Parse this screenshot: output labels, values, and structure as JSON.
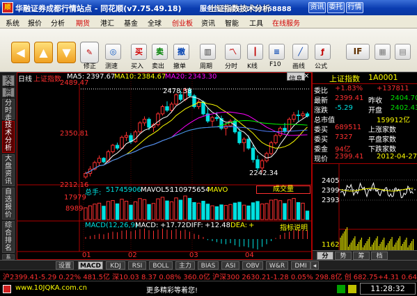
{
  "window": {
    "title": "华融证券成都行情站点 - 同花顺(v7.75.49.18)",
    "overlay": "服务热线:0571-56768888",
    "overlay_title": "上证指数技术分析",
    "buttons": [
      "资讯",
      "委托",
      "行情"
    ]
  },
  "menu": [
    "系统",
    "报价",
    "分析",
    "期货",
    "港汇",
    "基金",
    "全球",
    "创业板",
    "资讯",
    "智能",
    "工具",
    "在线服务"
  ],
  "menu_red": [
    "期货",
    "创业板",
    "在线服务"
  ],
  "toolbar": {
    "labels": [
      "修正",
      "测速",
      "买入",
      "卖出",
      "撤单",
      "周期",
      "分时",
      "K线",
      "F10",
      "画线",
      "公式"
    ],
    "buy_char": "买",
    "sell_char": "卖",
    "cancel_char": "撤",
    "if_label": "IF"
  },
  "left_tabs": [
    "分时走势",
    "技术分析",
    "大盘资讯",
    "自选报价",
    "综合排名",
    "系"
  ],
  "left_top_label": "关注",
  "left_top_label2": "资讯",
  "chart_header": {
    "period": "日线",
    "name": "上证指数",
    "ma5_label": "MA5:",
    "ma5": "2397.67",
    "ma10_label": "MA10:",
    "ma10": "2384.67",
    "ma20_label": "MA20:",
    "ma20": "2343.30",
    "info_btn": "信息",
    "info_close": "×"
  },
  "kline_axis": [
    "2489.47",
    "2350.81",
    "2212.16"
  ],
  "kline_annotations": {
    "high": "2478.38",
    "low": "2242.34"
  },
  "vol_header": {
    "label": "总手:",
    "value": "51745906",
    "mavol5_label": "MAVOL5:",
    "mavol5": "110975654",
    "mavol10_label": "MAVO",
    "selector": "成交量"
  },
  "vol_axis": [
    "17979",
    "8989"
  ],
  "macd_header": {
    "label": "MACD(12,26,9)",
    "macd_label": "MACD:",
    "macd": "+17.72",
    "diff_label": "DIFF:",
    "diff": "+12.48",
    "dea_label": "DEA:",
    "dea": "+",
    "btn": "指标说明"
  },
  "date_axis": [
    "01",
    "02",
    "03",
    "04"
  ],
  "right_panel": {
    "name": "上证指数",
    "code": "1A0001",
    "rows": [
      {
        "l": "委比",
        "v": "+1.83%",
        "r": "+137811"
      },
      {
        "l": "最新",
        "v": "2399.41",
        "l2": "昨收",
        "v2": "2404.70"
      },
      {
        "l": "涨跌",
        "v": "-5.29",
        "l2": "开盘",
        "v2": "2402.43"
      },
      {
        "l": "总市值",
        "v": "",
        "r": "159912亿"
      },
      {
        "l": "委买",
        "v": "689511",
        "l2": "上涨家数",
        "v2": ""
      },
      {
        "l": "委买",
        "v": "7327",
        "l2": "平盘家数",
        "v2": ""
      },
      {
        "l": "委金",
        "v": "94亿",
        "l2": "下跌家数",
        "v2": ""
      },
      {
        "l": "现价",
        "v": "2399.41",
        "r": "2012-04-27"
      }
    ],
    "mini_axis": [
      "2405",
      "2399",
      "2393"
    ],
    "mini_vol": "1162",
    "tabs": [
      "分",
      "势",
      "筹",
      "档"
    ]
  },
  "bottom_tabs": [
    "设置",
    "MACD",
    "KDJ",
    "RSI",
    "BOLL",
    "主力",
    "BIAS",
    "ASI",
    "OBV",
    "W&R",
    "DMI"
  ],
  "ticker": "沪2399.41-5.29 0.22% 481.5亿 深10.03 8.37 0.08% 360.0亿 沪深300 2630.21-1.28 0.05% 298.8亿 创 682.75+4.31 0.64%",
  "status": {
    "url": "www.10JQKA.com.cn",
    "promo": "更多精彩等着您!",
    "time": "11:28:32"
  },
  "colors": {
    "up": "#ff3030",
    "down": "#00e0e0",
    "ma5": "#ffffff",
    "ma10": "#ffff00",
    "ma20": "#ff00ff",
    "ma30": "#00ff00",
    "ma60": "#5080ff",
    "frame": "#b00000"
  },
  "chart_data": [
    {
      "type": "candlestick",
      "title": "上证指数 日线",
      "yaxis": [
        2212.16,
        2489.47
      ],
      "x_ticks": [
        "01",
        "02",
        "03",
        "04"
      ],
      "ohlc": [
        [
          2230,
          2245,
          2225,
          2240
        ],
        [
          2240,
          2260,
          2232,
          2252
        ],
        [
          2252,
          2275,
          2248,
          2270
        ],
        [
          2270,
          2290,
          2262,
          2282
        ],
        [
          2282,
          2285,
          2268,
          2272
        ],
        [
          2272,
          2305,
          2270,
          2300
        ],
        [
          2300,
          2322,
          2295,
          2318
        ],
        [
          2318,
          2325,
          2305,
          2310
        ],
        [
          2310,
          2345,
          2308,
          2340
        ],
        [
          2340,
          2355,
          2330,
          2345
        ],
        [
          2345,
          2352,
          2322,
          2328
        ],
        [
          2328,
          2360,
          2325,
          2355
        ],
        [
          2355,
          2385,
          2350,
          2380
        ],
        [
          2380,
          2398,
          2372,
          2390
        ],
        [
          2390,
          2395,
          2360,
          2368
        ],
        [
          2368,
          2380,
          2355,
          2375
        ],
        [
          2375,
          2410,
          2370,
          2405
        ],
        [
          2405,
          2430,
          2400,
          2425
        ],
        [
          2425,
          2440,
          2410,
          2415
        ],
        [
          2415,
          2438,
          2408,
          2432
        ],
        [
          2432,
          2462,
          2428,
          2458
        ],
        [
          2458,
          2470,
          2440,
          2445
        ],
        [
          2445,
          2478,
          2440,
          2472
        ],
        [
          2472,
          2478,
          2450,
          2455
        ],
        [
          2455,
          2460,
          2420,
          2425
        ],
        [
          2425,
          2445,
          2418,
          2438
        ],
        [
          2438,
          2442,
          2400,
          2405
        ],
        [
          2405,
          2420,
          2380,
          2385
        ],
        [
          2385,
          2400,
          2370,
          2395
        ],
        [
          2395,
          2410,
          2385,
          2392
        ],
        [
          2392,
          2400,
          2360,
          2365
        ],
        [
          2365,
          2380,
          2345,
          2372
        ],
        [
          2372,
          2390,
          2368,
          2385
        ],
        [
          2385,
          2392,
          2350,
          2355
        ],
        [
          2355,
          2365,
          2320,
          2325
        ],
        [
          2325,
          2340,
          2300,
          2335
        ],
        [
          2335,
          2345,
          2305,
          2310
        ],
        [
          2310,
          2320,
          2270,
          2278
        ],
        [
          2278,
          2290,
          2248,
          2255
        ],
        [
          2255,
          2280,
          2242,
          2275
        ],
        [
          2275,
          2300,
          2270,
          2295
        ],
        [
          2295,
          2330,
          2290,
          2325
        ],
        [
          2325,
          2350,
          2320,
          2345
        ],
        [
          2345,
          2370,
          2340,
          2365
        ],
        [
          2365,
          2380,
          2350,
          2358
        ],
        [
          2358,
          2395,
          2355,
          2390
        ],
        [
          2390,
          2410,
          2382,
          2402
        ],
        [
          2402,
          2415,
          2385,
          2400
        ],
        [
          2400,
          2412,
          2392,
          2405
        ],
        [
          2405,
          2410,
          2395,
          2399
        ]
      ]
    },
    {
      "type": "bar",
      "title": "成交量",
      "yaxis": [
        0,
        17979
      ],
      "values": [
        9000,
        10500,
        11800,
        12500,
        10200,
        13800,
        14500,
        12000,
        15500,
        14000,
        11000,
        13500,
        16000,
        15200,
        11500,
        12300,
        15800,
        17000,
        14200,
        13500,
        16500,
        14800,
        17979,
        16200,
        13000,
        12500,
        14000,
        11800,
        10500,
        9800,
        11200,
        10800,
        11500,
        12600,
        13200,
        11000,
        10400,
        12800,
        13800,
        11900,
        12200,
        14800,
        15200,
        14400,
        12200,
        15000,
        16100,
        13000,
        12500,
        6500
      ],
      "up": [
        1,
        1,
        1,
        1,
        0,
        1,
        1,
        0,
        1,
        1,
        0,
        1,
        1,
        1,
        0,
        1,
        1,
        1,
        0,
        1,
        1,
        0,
        1,
        0,
        0,
        1,
        0,
        0,
        1,
        0,
        0,
        1,
        1,
        0,
        0,
        1,
        0,
        0,
        0,
        1,
        1,
        1,
        1,
        1,
        0,
        1,
        1,
        0,
        1,
        0
      ]
    },
    {
      "type": "bar",
      "title": "MACD(12,26,9)",
      "values": [
        4,
        6,
        8,
        10,
        9,
        12,
        14,
        13,
        16,
        17,
        15,
        17,
        19,
        20,
        17,
        16,
        18,
        20,
        18,
        17,
        19,
        16,
        18,
        14,
        10,
        8,
        4,
        -2,
        -4,
        -6,
        -9,
        -10,
        -8,
        -12,
        -15,
        -14,
        -16,
        -18,
        -20,
        -15,
        -10,
        -4,
        2,
        8,
        12,
        14,
        17,
        18,
        18,
        17
      ]
    }
  ]
}
